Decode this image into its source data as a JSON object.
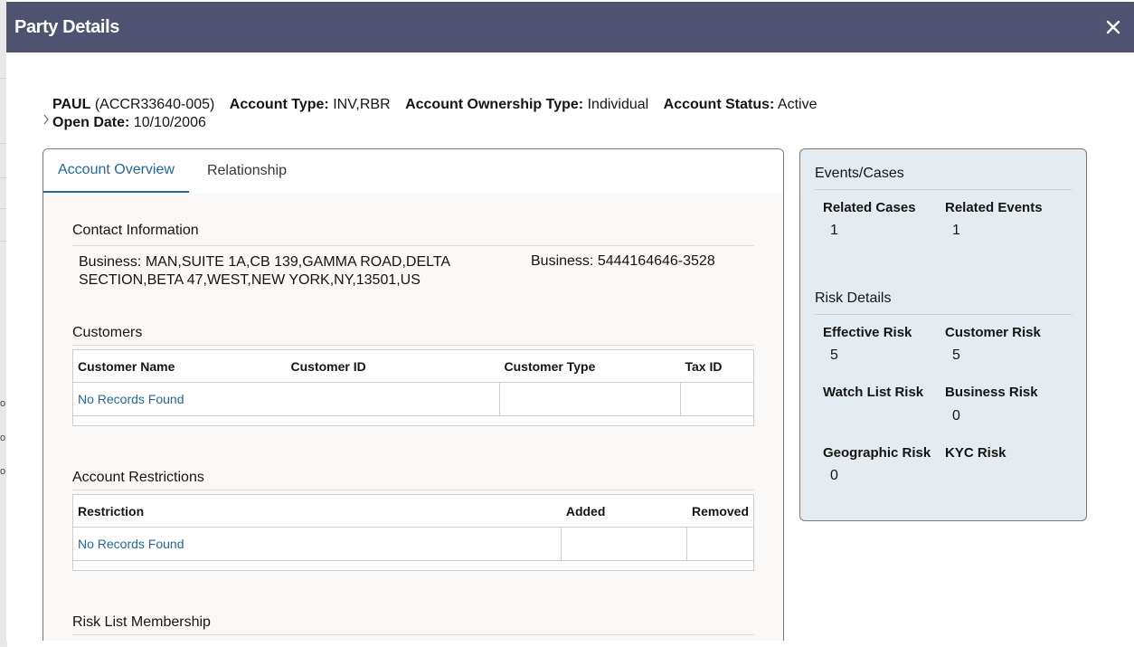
{
  "modal": {
    "title": "Party Details",
    "close_label": "×"
  },
  "summary": {
    "name": "PAUL",
    "account_id": "(ACCR33640-005)",
    "account_type_label": "Account Type:",
    "account_type_value": "INV,RBR",
    "ownership_type_label": "Account Ownership Type:",
    "ownership_type_value": "Individual",
    "status_label": "Account Status:",
    "status_value": "Active",
    "open_date_label": "Open Date:",
    "open_date_value": "10/10/2006"
  },
  "tabs": [
    {
      "label": "Account Overview",
      "active": true
    },
    {
      "label": "Relationship",
      "active": false
    }
  ],
  "contact": {
    "title": "Contact Information",
    "address_line1": "Business: MAN,SUITE 1A,CB 139,GAMMA ROAD,DELTA",
    "address_line2": "SECTION,BETA 47,WEST,NEW YORK,NY,13501,US",
    "phone": "Business: 5444164646-3528"
  },
  "customers": {
    "title": "Customers",
    "columns": [
      "Customer Name",
      "Customer ID",
      "Customer Type",
      "Tax ID"
    ],
    "empty_text": "No Records Found"
  },
  "restrictions": {
    "title": "Account Restrictions",
    "columns": [
      "Restriction",
      "Added",
      "Removed"
    ],
    "empty_text": "No Records Found"
  },
  "risk_list": {
    "title": "Risk List Membership"
  },
  "events_cases": {
    "title": "Events/Cases",
    "related_cases_label": "Related Cases",
    "related_cases_value": "1",
    "related_events_label": "Related Events",
    "related_events_value": "1"
  },
  "risk_details": {
    "title": "Risk Details",
    "effective_risk_label": "Effective Risk",
    "effective_risk_value": "5",
    "customer_risk_label": "Customer Risk",
    "customer_risk_value": "5",
    "watch_list_risk_label": "Watch List Risk",
    "business_risk_label": "Business Risk",
    "business_risk_value": "0",
    "geographic_risk_label": "Geographic Risk",
    "geographic_risk_value": "0",
    "kyc_risk_label": "KYC Risk"
  },
  "background": {
    "fragments": [
      "o",
      "o",
      "o"
    ]
  },
  "colors": {
    "header_bg": "#4f5371",
    "link_blue": "#22689f",
    "side_panel_bg": "#e4ecf2"
  }
}
